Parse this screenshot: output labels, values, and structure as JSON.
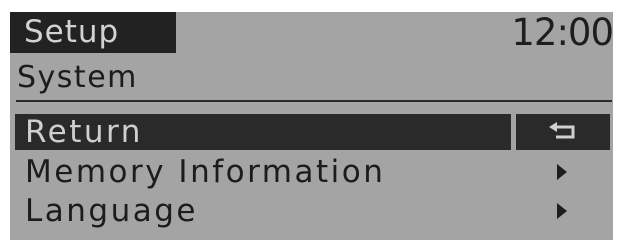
{
  "header": {
    "tab_label": "Setup",
    "clock": "12:00"
  },
  "section": {
    "title": "System"
  },
  "menu": {
    "items": [
      {
        "label": "Return",
        "selected": true,
        "indicator": "return-arrow-icon"
      },
      {
        "label": "Memory Information",
        "selected": false,
        "indicator": "chevron-right-icon"
      },
      {
        "label": "Language",
        "selected": false,
        "indicator": "chevron-right-icon"
      }
    ]
  },
  "colors": {
    "screen_background": "#a4a4a4",
    "dark": "#2a2a2a",
    "light_text": "#cfcfcf",
    "dark_text": "#1c1c1c"
  }
}
